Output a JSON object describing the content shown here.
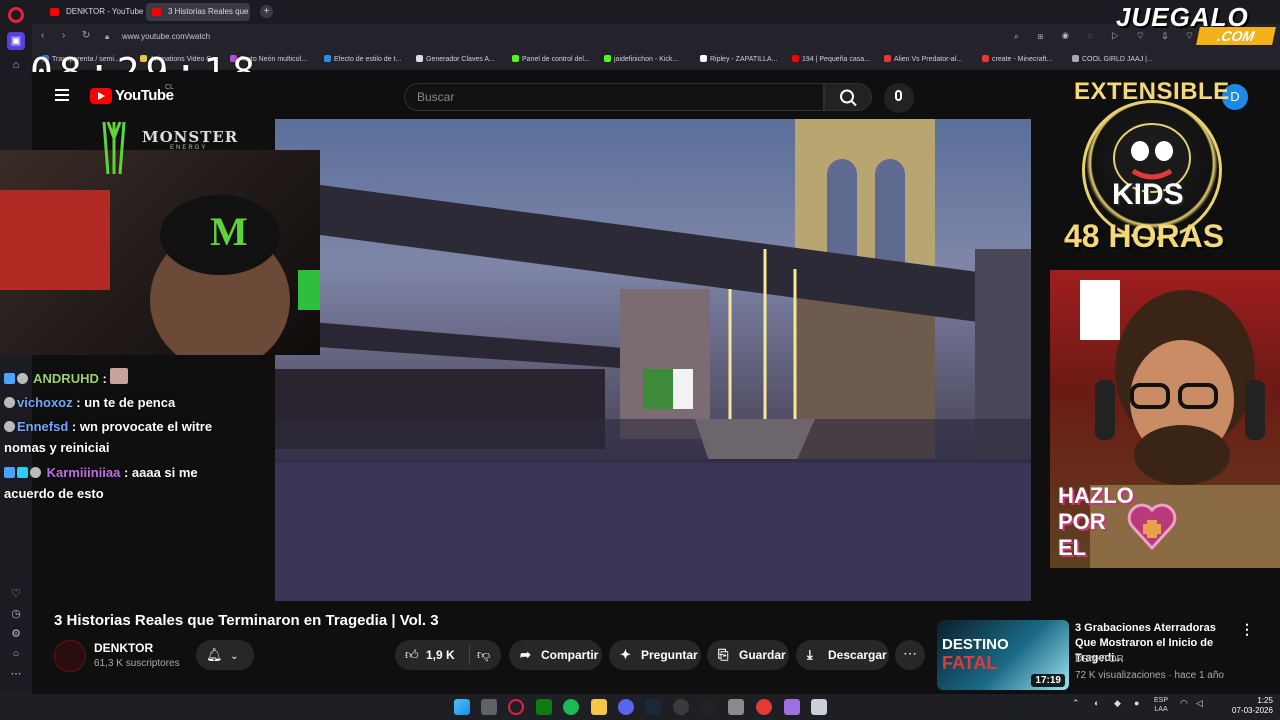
{
  "browser": {
    "tabs": [
      {
        "label": "DENKTOR - YouTube"
      },
      {
        "label": "3 Historias Reales que"
      }
    ],
    "url": "www.youtube.com/watch",
    "bookmarks": [
      {
        "label": "Transparenta / semi...",
        "color": "#3a7bd5"
      },
      {
        "label": "Animations Video C...",
        "color": "#e8c547"
      },
      {
        "label": "Texto Neón multicol...",
        "color": "#b04fd6"
      },
      {
        "label": "Efecto de estilo de t...",
        "color": "#2e8be6"
      },
      {
        "label": "Generador Claves A...",
        "color": "#dddddd"
      },
      {
        "label": "Panel de control del...",
        "color": "#53fc18"
      },
      {
        "label": "jaidefinichon - Kick...",
        "color": "#53fc18"
      },
      {
        "label": "Ripley - ZAPATILLA...",
        "color": "#ffffff"
      },
      {
        "label": "194 | Pequeña casa...",
        "color": "#ff0000"
      },
      {
        "label": "Alien Vs Predator-al...",
        "color": "#e53935"
      },
      {
        "label": "create - Minecraft...",
        "color": "#e53935"
      },
      {
        "label": "COOL GIRLD JAAJ |...",
        "color": "#aaaaaa"
      }
    ]
  },
  "overlay": {
    "clock": "08:29:18",
    "brand": "JUEGALO",
    "brand_suffix": ".COM",
    "monster": "MONSTER",
    "monster_sub": "ENERGY",
    "extensible": "EXTENSIBLE",
    "kids": "KIDS",
    "hours": "48 HORAS",
    "hazlo": "HAZLO",
    "por": "POR",
    "el": "EL",
    "chat": [
      {
        "user": "ANDRUHD",
        "message": ""
      },
      {
        "user": "vichoxoz",
        "message": "un te de penca"
      },
      {
        "user": "Ennefsd",
        "message": "wn provocate el witre nomas y reiniciai"
      },
      {
        "user": "Karmiiiniiaa",
        "message": "aaaa si me acuerdo de esto"
      }
    ]
  },
  "youtube": {
    "wordmark": "YouTube",
    "country": "CL",
    "search_placeholder": "Buscar",
    "avatar_letter": "D",
    "video_title": "3 Historias Reales que Terminaron en Tragedia | Vol. 3",
    "channel": "DENKTOR",
    "subscribers": "61,3 K suscriptores",
    "likes": "1,9 K",
    "actions": {
      "share": "Compartir",
      "ask": "Preguntar",
      "save": "Guardar",
      "download": "Descargar"
    },
    "recommendation": {
      "title": "3 Grabaciones Aterradoras Que Mostraron el Inicio de Tragedi...",
      "channel": "DENKTOR",
      "meta": "72 K visualizaciones · hace 1 año",
      "duration": "17:19",
      "thumb_line1": "DESTINO",
      "thumb_line2": "FATAL"
    }
  },
  "taskbar": {
    "language": "ESP",
    "language_sub": "LAA",
    "time": "1:25",
    "date": "07-03-2026"
  }
}
